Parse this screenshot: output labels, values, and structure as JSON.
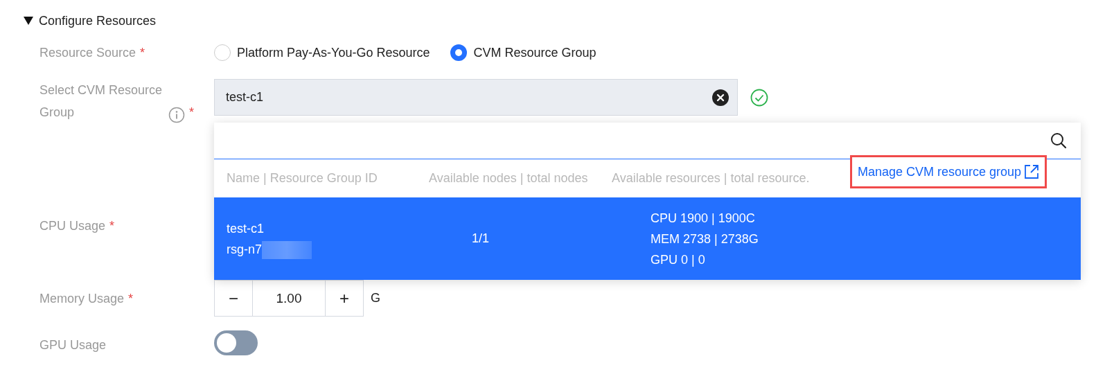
{
  "section": {
    "title": "Configure Resources",
    "expanded": true
  },
  "fields": [
    {
      "kind": "radio",
      "label": "Resource Source",
      "required_mark": "*",
      "options": [
        {
          "label": "Platform Pay-As-You-Go Resource",
          "selected": false
        },
        {
          "label": "CVM Resource Group",
          "selected": true
        }
      ]
    },
    {
      "kind": "select",
      "label": "Select CVM Resource Group",
      "info": true,
      "required_mark": "*",
      "value": "test-c1",
      "valid": true
    },
    {
      "kind": "covered",
      "label": "CPU Usage",
      "required_mark": "*"
    },
    {
      "kind": "stepper",
      "label": "Memory Usage",
      "required_mark": "*",
      "decrement": "−",
      "value": "1.00",
      "increment": "+",
      "unit": "G"
    },
    {
      "kind": "toggle",
      "label": "GPU Usage",
      "on": false
    }
  ],
  "dropdown": {
    "open": true,
    "columns": [
      "Name | Resource Group ID",
      "Available nodes | total nodes",
      "Available resources | total resource."
    ],
    "manage_link": {
      "label": "Manage CVM resource group",
      "highlighted": true
    },
    "rows": [
      {
        "name": "test-c1",
        "id": "rsg-n7",
        "nodes": "1/1",
        "resources": [
          "CPU 1900 | 1900C",
          "MEM 2738 | 2738G",
          "GPU 0 | 0"
        ],
        "selected": true
      }
    ]
  }
}
